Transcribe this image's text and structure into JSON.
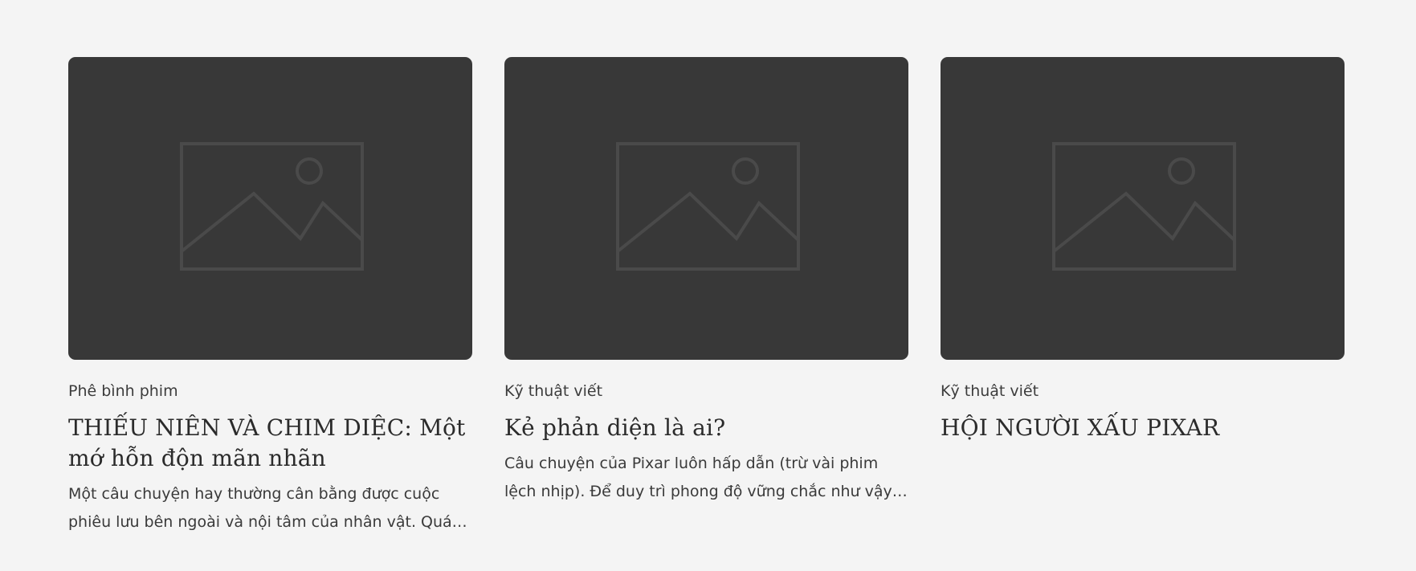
{
  "posts": [
    {
      "category": "Phê bình phim",
      "title": "THIẾU NIÊN VÀ CHIM DIỆC: Một mớ hỗn độn mãn nhãn",
      "excerpt": "Một câu chuyện hay thường cân bằng được cuộc phiêu lưu bên ngoài và nội tâm của nhân vật. Quá ch…",
      "image_icon": "image-placeholder-icon"
    },
    {
      "category": "Kỹ thuật viết",
      "title": "Kẻ phản diện là ai?",
      "excerpt": "Câu chuyện của Pixar luôn hấp dẫn (trừ vài phim lệch nhịp). Để duy trì phong độ vững chắc như vậy, thứ…",
      "image_icon": "image-placeholder-icon"
    },
    {
      "category": "Kỹ thuật viết",
      "title": "HỘI NGƯỜI XẤU PIXAR",
      "excerpt": "",
      "image_icon": "image-placeholder-icon"
    }
  ],
  "colors": {
    "background": "#f4f4f4",
    "image_placeholder": "#383838",
    "icon_stroke": "#4a4a4a",
    "text": "#2f2f2f"
  }
}
